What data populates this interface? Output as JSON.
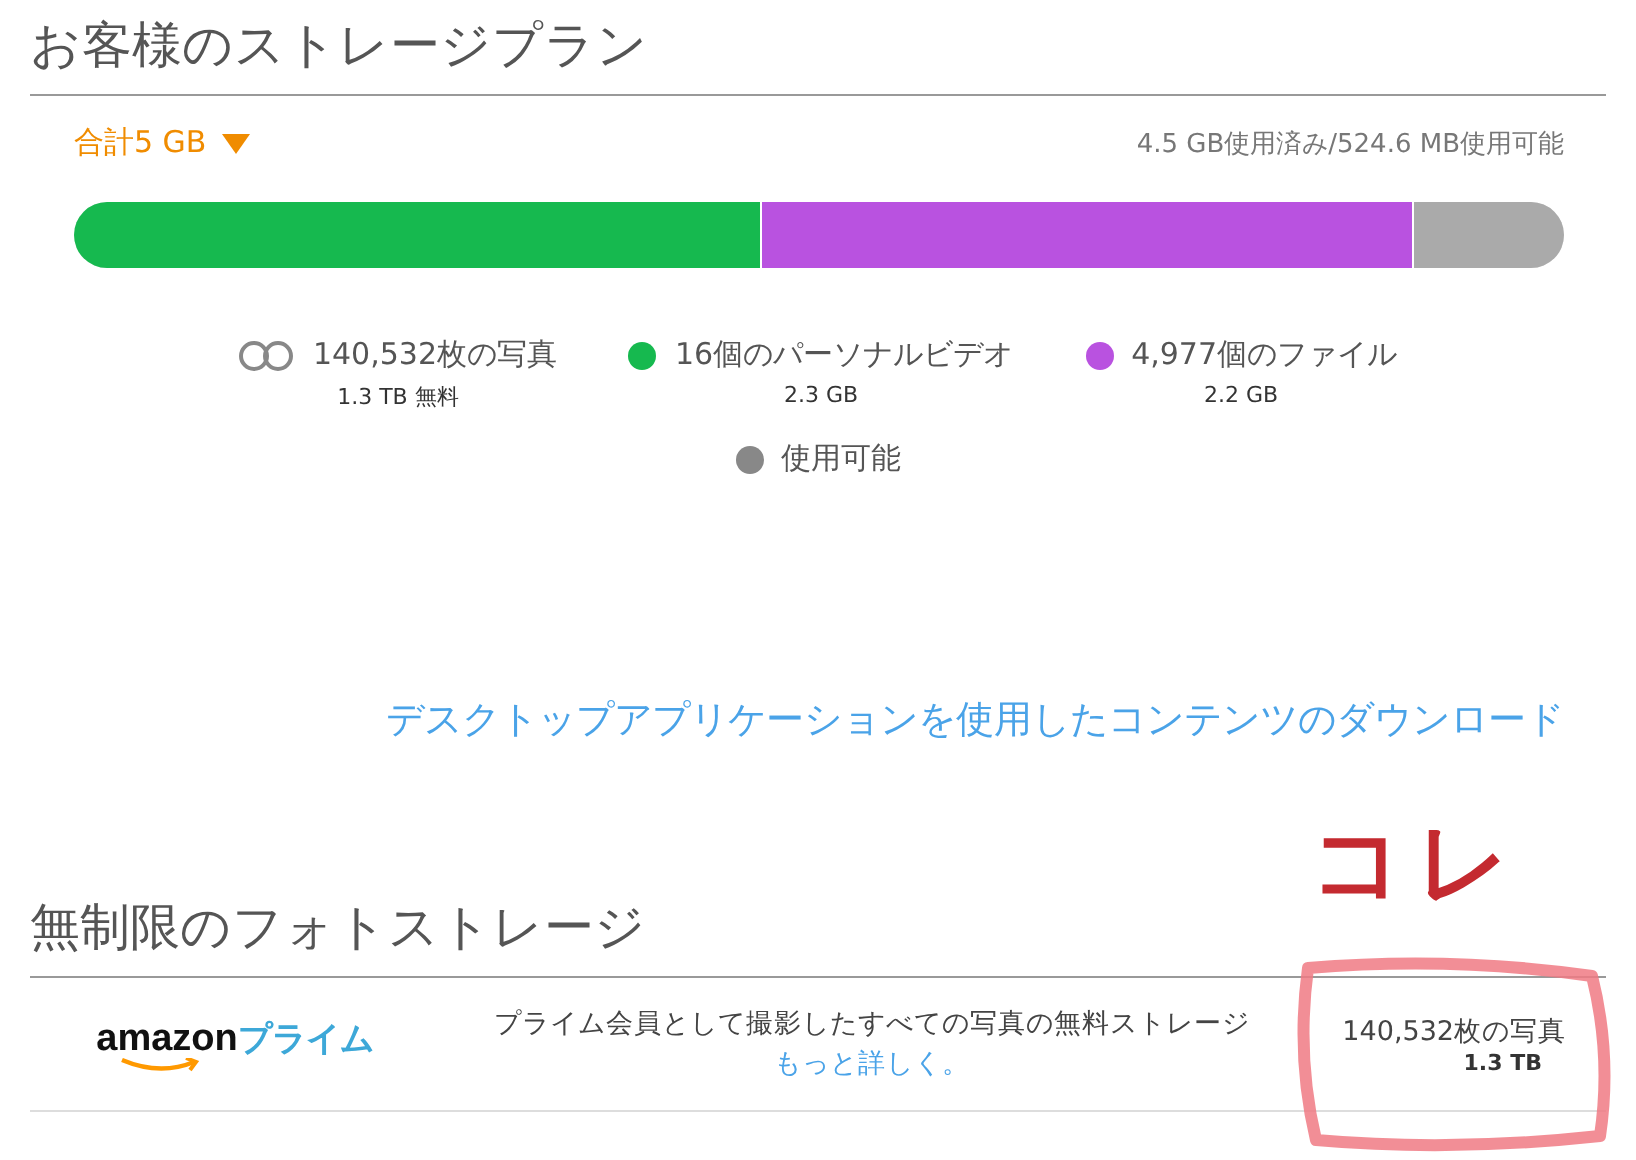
{
  "storage": {
    "title": "お客様のストレージプラン",
    "total": "合計5 GB",
    "usage": "4.5 GB使用済み/524.6 MB使用可能",
    "bar": [
      {
        "color": "#16b94f",
        "level": 0.46
      },
      {
        "color": "#b952e0"
      },
      {
        "color": "#aaaaaa",
        "level": 0.1025
      }
    ],
    "legend": [
      {
        "kind": "photos",
        "label": "140,532枚の写真",
        "detail": "1.3 TB 無料"
      },
      {
        "kind": "dot",
        "color": "#16b94f",
        "label": "16個のパーソナルビデオ",
        "detail": "2.3 GB"
      },
      {
        "kind": "dot",
        "color": "#b952e0",
        "label": "4,977個のファイル",
        "detail": "2.2 GB"
      },
      {
        "kind": "dot",
        "color": "#888888",
        "label": "使用可能"
      }
    ],
    "download_link": "デスクトップアプリケーションを使用したコンテンツのダウンロード"
  },
  "unlimited": {
    "title": "無制限のフォトストレージ",
    "logo": {
      "brand": "amazon",
      "service": "プライム"
    },
    "description": "プライム会員として撮影したすべての写真の無料ストレージ",
    "more_link": "もっと詳しく。",
    "count": "140,532枚の写真",
    "size": "1.3 TB"
  },
  "annotation": {
    "text": "コレ"
  }
}
